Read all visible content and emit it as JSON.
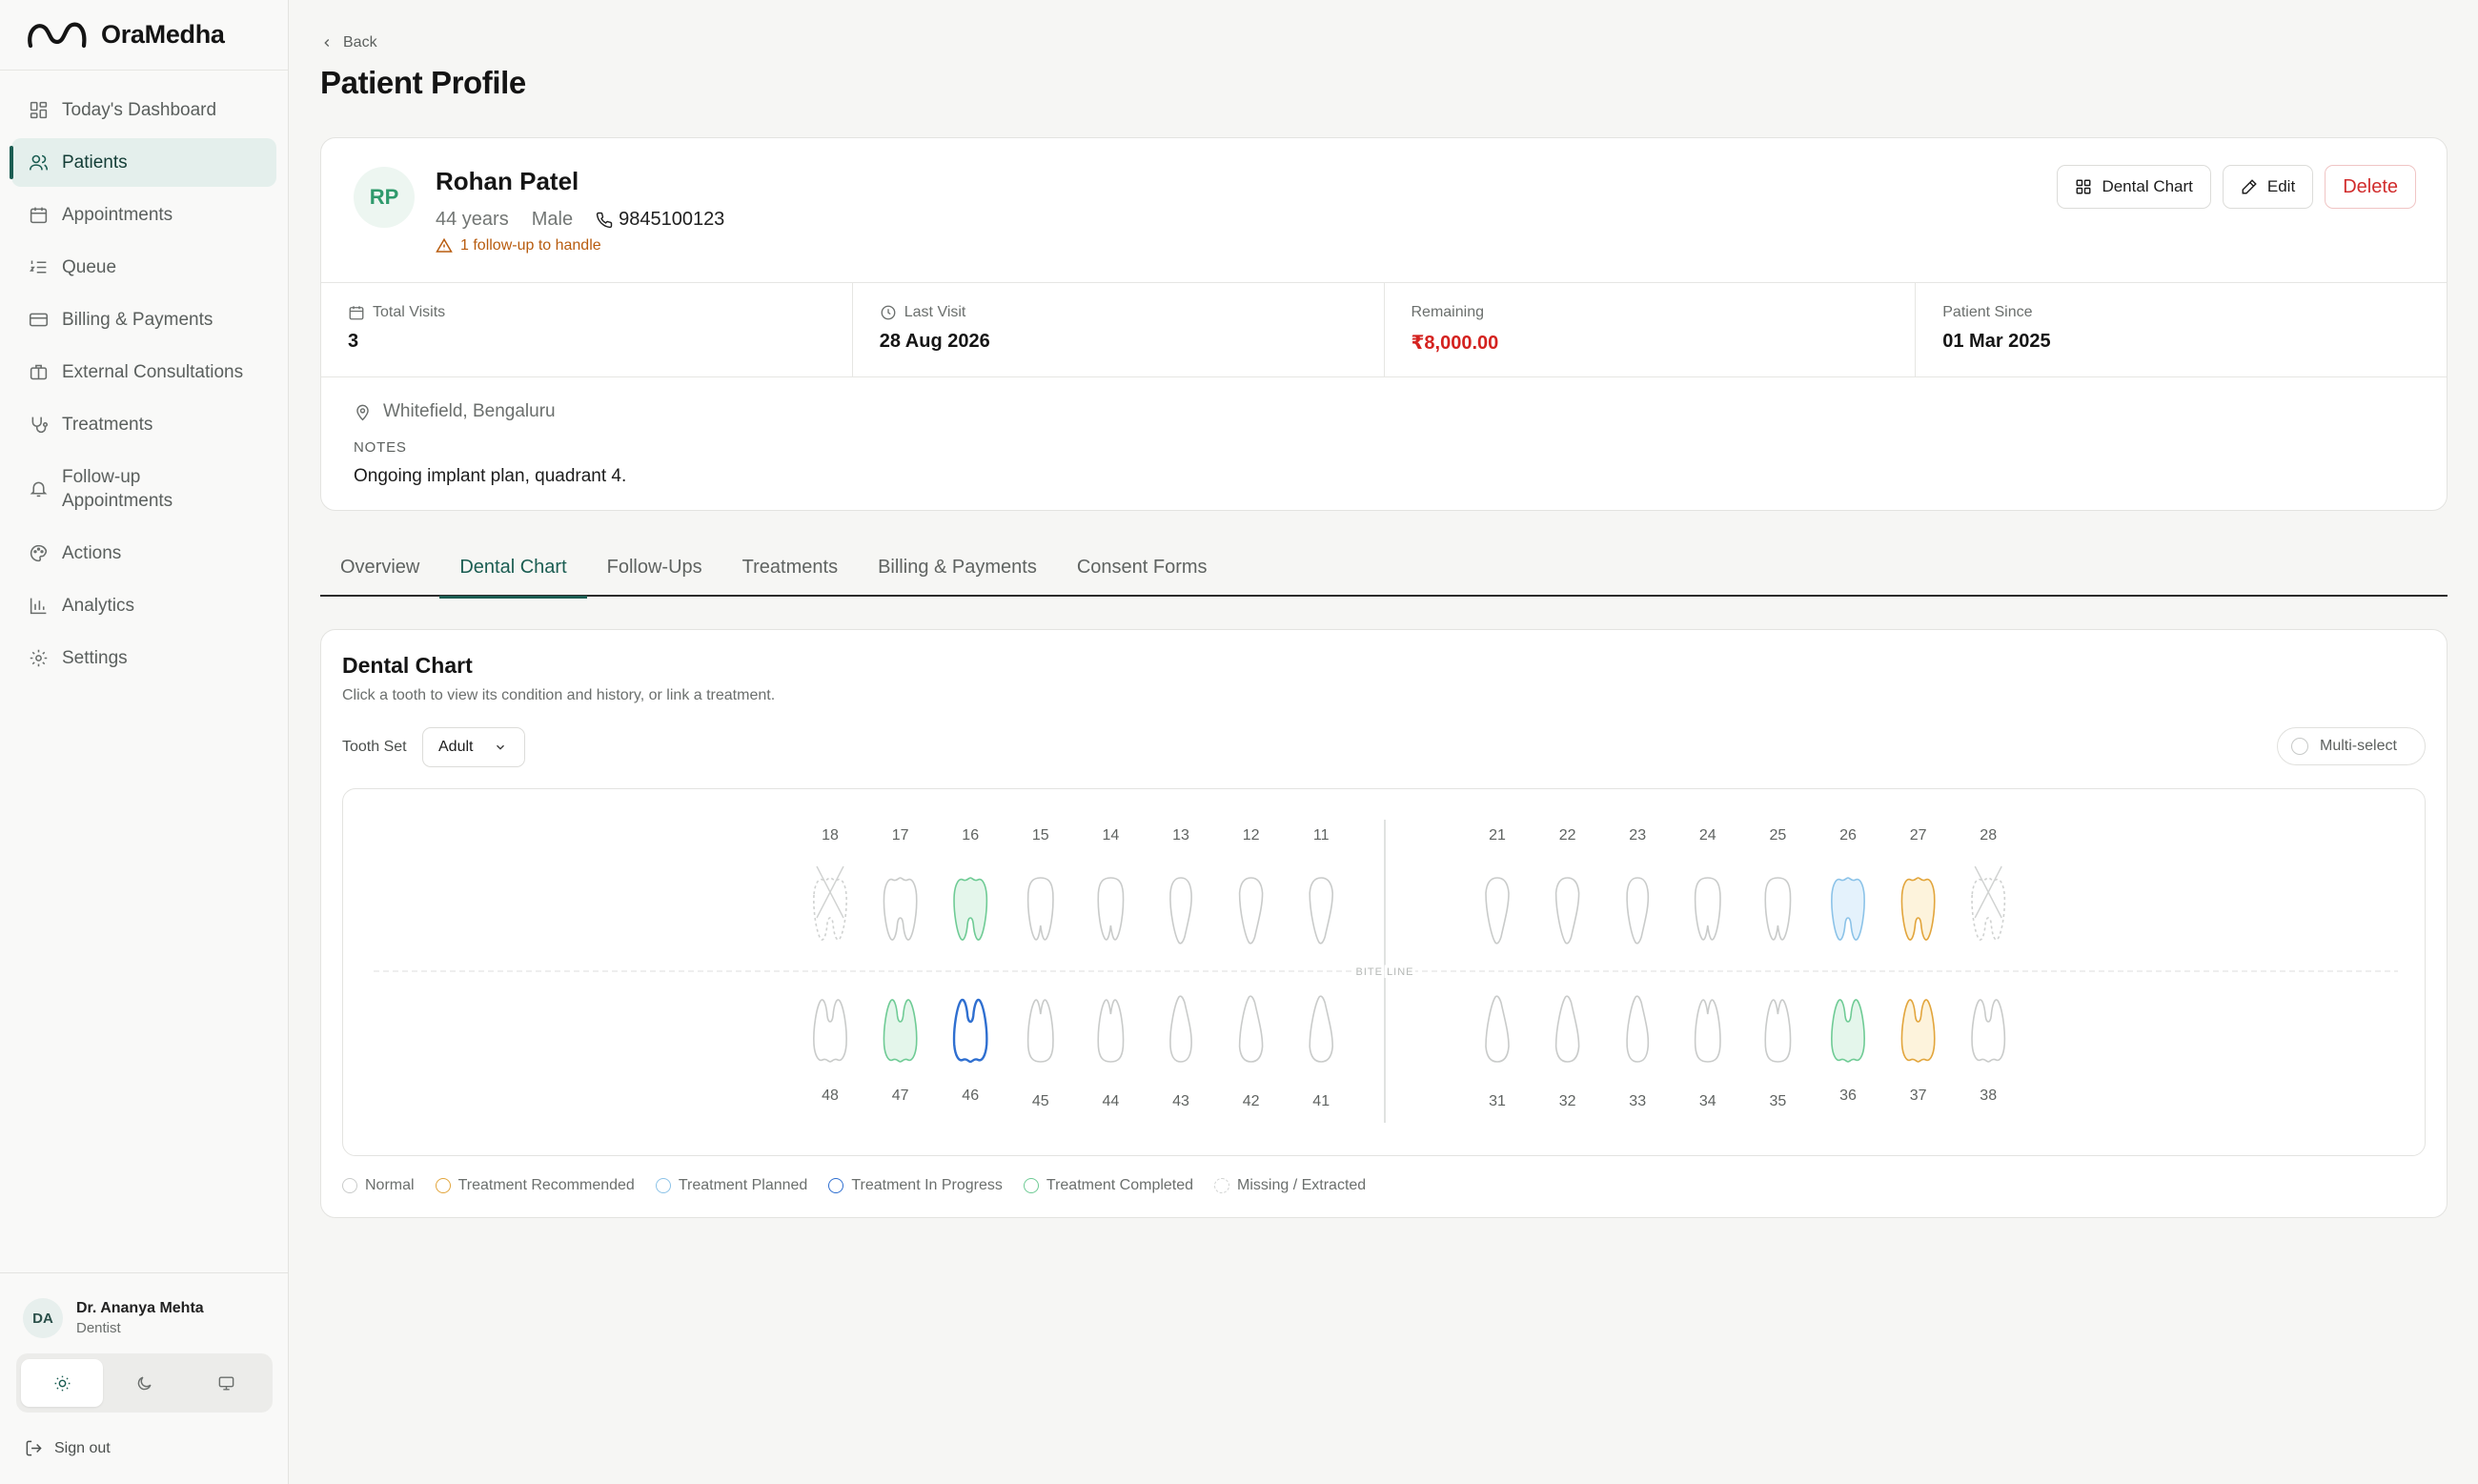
{
  "app": {
    "name": "OraMedha"
  },
  "sidebar": {
    "items": [
      {
        "label": "Today's Dashboard",
        "icon": "dashboard-icon"
      },
      {
        "label": "Patients",
        "icon": "users-icon",
        "active": true
      },
      {
        "label": "Appointments",
        "icon": "calendar-icon"
      },
      {
        "label": "Queue",
        "icon": "list-ordered-icon"
      },
      {
        "label": "Billing & Payments",
        "icon": "credit-card-icon"
      },
      {
        "label": "External Consultations",
        "icon": "briefcase-icon"
      },
      {
        "label": "Treatments",
        "icon": "stethoscope-icon"
      },
      {
        "label": "Follow-up",
        "label2": "Appointments",
        "icon": "bell-icon"
      },
      {
        "label": "Actions",
        "icon": "palette-icon"
      },
      {
        "label": "Analytics",
        "icon": "bar-chart-icon"
      },
      {
        "label": "Settings",
        "icon": "gear-icon"
      }
    ],
    "user": {
      "initials": "DA",
      "name": "Dr. Ananya Mehta",
      "role": "Dentist"
    },
    "theme_options": [
      "light-theme-icon",
      "dark-theme-icon",
      "system-theme-icon"
    ],
    "signout_label": "Sign out"
  },
  "page": {
    "back_label": "Back",
    "title": "Patient Profile"
  },
  "patient": {
    "initials": "RP",
    "name": "Rohan Patel",
    "age": "44 years",
    "gender": "Male",
    "phone": "9845100123",
    "alert": "1 follow-up to handle",
    "location": "Whitefield, Bengaluru",
    "notes_label": "NOTES",
    "notes": "Ongoing implant plan, quadrant 4."
  },
  "actions": {
    "dental_chart": "Dental Chart",
    "edit": "Edit",
    "delete": "Delete"
  },
  "stats": [
    {
      "label": "Total Visits",
      "value": "3",
      "icon": "calendar-icon"
    },
    {
      "label": "Last Visit",
      "value": "28 Aug 2026",
      "icon": "clock-icon"
    },
    {
      "label": "Remaining",
      "value": "₹8,000.00",
      "icon": "",
      "highlight": true
    },
    {
      "label": "Patient Since",
      "value": "01 Mar 2025",
      "icon": ""
    }
  ],
  "tabs": [
    {
      "label": "Overview"
    },
    {
      "label": "Dental Chart",
      "active": true
    },
    {
      "label": "Follow-Ups"
    },
    {
      "label": "Treatments"
    },
    {
      "label": "Billing & Payments"
    },
    {
      "label": "Consent Forms"
    }
  ],
  "dental_chart": {
    "title": "Dental Chart",
    "subtitle": "Click a tooth to view its condition and history, or link a treatment.",
    "tooth_set_label": "Tooth Set",
    "tooth_set_value": "Adult",
    "multi_select_label": "Multi-select",
    "bite_line_label": "BITE LINE",
    "upper_right": [
      {
        "num": "18",
        "status": "missing"
      },
      {
        "num": "17",
        "status": "normal"
      },
      {
        "num": "16",
        "status": "completed"
      },
      {
        "num": "15",
        "status": "normal"
      },
      {
        "num": "14",
        "status": "normal"
      },
      {
        "num": "13",
        "status": "normal"
      },
      {
        "num": "12",
        "status": "normal"
      },
      {
        "num": "11",
        "status": "normal"
      }
    ],
    "upper_left": [
      {
        "num": "21",
        "status": "normal"
      },
      {
        "num": "22",
        "status": "normal"
      },
      {
        "num": "23",
        "status": "normal"
      },
      {
        "num": "24",
        "status": "normal"
      },
      {
        "num": "25",
        "status": "normal"
      },
      {
        "num": "26",
        "status": "planned"
      },
      {
        "num": "27",
        "status": "recommended"
      },
      {
        "num": "28",
        "status": "missing"
      }
    ],
    "lower_right": [
      {
        "num": "48",
        "status": "normal"
      },
      {
        "num": "47",
        "status": "completed"
      },
      {
        "num": "46",
        "status": "in_progress"
      },
      {
        "num": "45",
        "status": "normal"
      },
      {
        "num": "44",
        "status": "normal"
      },
      {
        "num": "43",
        "status": "normal"
      },
      {
        "num": "42",
        "status": "normal"
      },
      {
        "num": "41",
        "status": "normal"
      }
    ],
    "lower_left": [
      {
        "num": "31",
        "status": "normal"
      },
      {
        "num": "32",
        "status": "normal"
      },
      {
        "num": "33",
        "status": "normal"
      },
      {
        "num": "34",
        "status": "normal"
      },
      {
        "num": "35",
        "status": "normal"
      },
      {
        "num": "36",
        "status": "completed"
      },
      {
        "num": "37",
        "status": "recommended"
      },
      {
        "num": "38",
        "status": "normal"
      }
    ],
    "legend": [
      {
        "label": "Normal",
        "status": "normal"
      },
      {
        "label": "Treatment Recommended",
        "status": "recommended"
      },
      {
        "label": "Treatment Planned",
        "status": "planned"
      },
      {
        "label": "Treatment In Progress",
        "status": "in_progress"
      },
      {
        "label": "Treatment Completed",
        "status": "completed"
      },
      {
        "label": "Missing / Extracted",
        "status": "missing"
      }
    ],
    "status_colors": {
      "normal": {
        "stroke": "#c9cbca",
        "fill": "#ffffff"
      },
      "recommended": {
        "stroke": "#e2a53c",
        "fill": "#fdf3dc"
      },
      "planned": {
        "stroke": "#8cc3e8",
        "fill": "#e4f2fc"
      },
      "in_progress": {
        "stroke": "#2f6fd0",
        "fill": "#ffffff"
      },
      "completed": {
        "stroke": "#6fcb95",
        "fill": "#e4f6eb"
      },
      "missing": {
        "stroke": "#d0d2d1",
        "fill": "#ffffff"
      }
    }
  },
  "colors": {
    "accent": "#1b5d52",
    "danger": "#d12c2c",
    "warning": "#b85c0f"
  }
}
